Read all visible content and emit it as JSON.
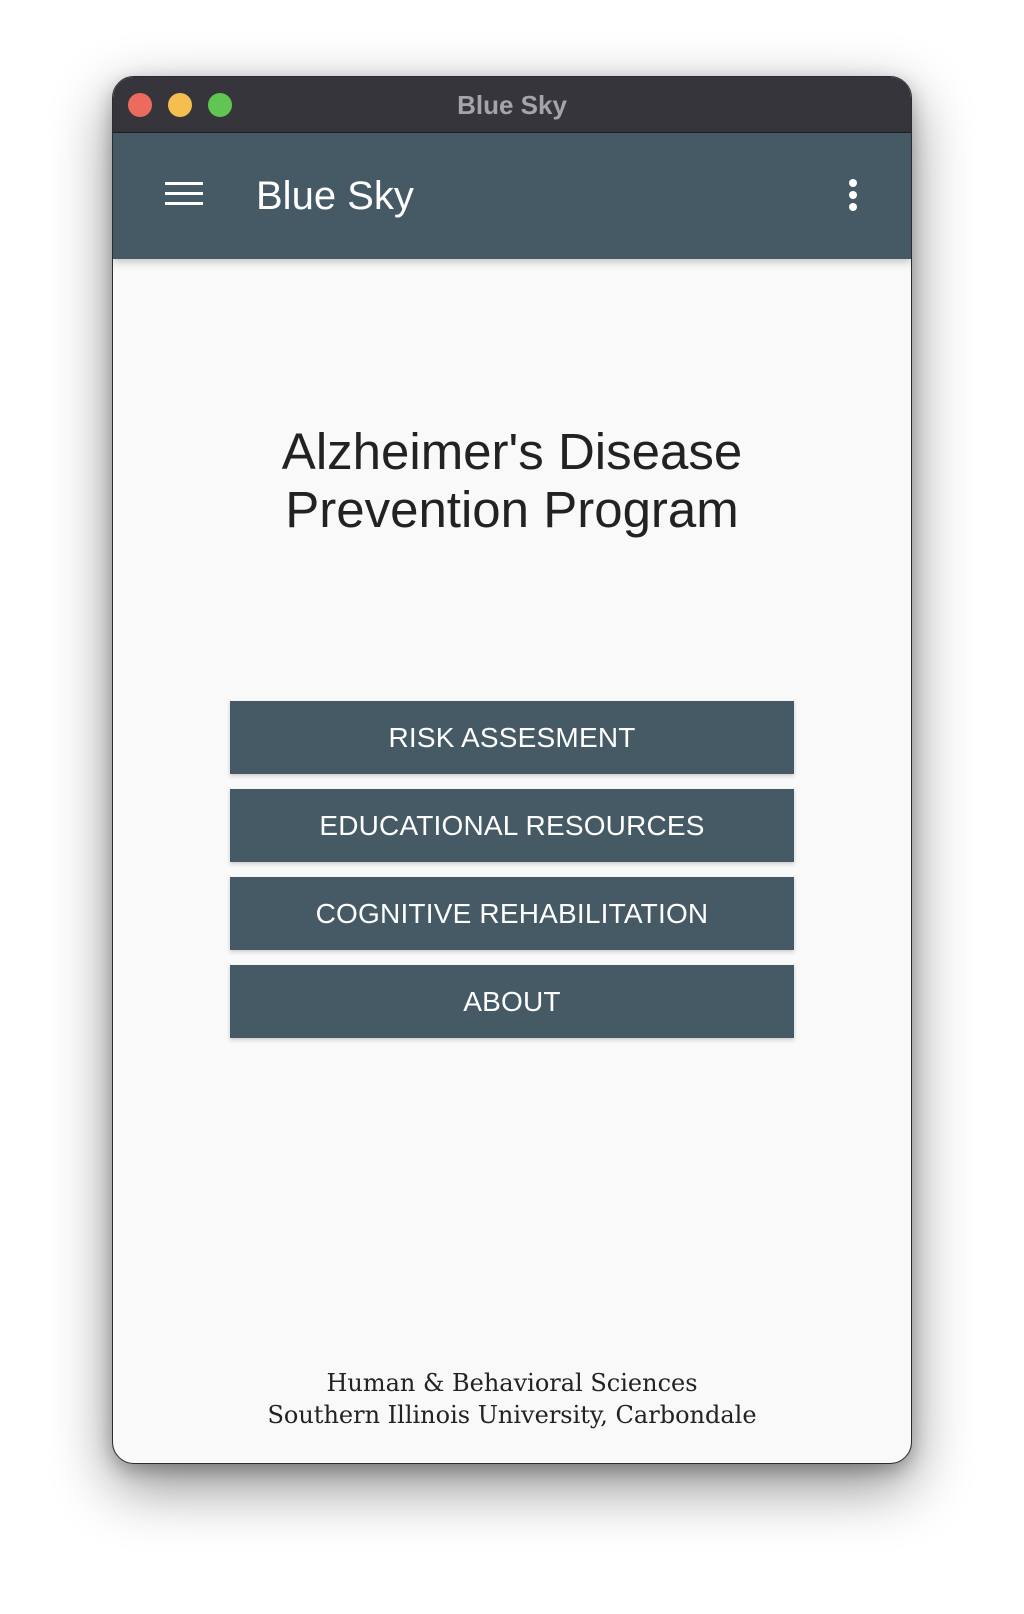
{
  "window": {
    "title": "Blue Sky"
  },
  "colors": {
    "appbar": "#455a64",
    "button": "#455a64",
    "background": "#f9f9f9",
    "titlebar": "#36353c",
    "traffic_close": "#ed6a5e",
    "traffic_minimize": "#f5bf4f",
    "traffic_zoom": "#61c554"
  },
  "appbar": {
    "menu_icon": "hamburger-menu-icon",
    "title": "Blue Sky",
    "overflow_icon": "more-vertical-icon"
  },
  "main": {
    "heading_line1": "Alzheimer's Disease",
    "heading_line2": "Prevention Program",
    "buttons": [
      {
        "label": "RISK ASSESMENT"
      },
      {
        "label": "EDUCATIONAL RESOURCES"
      },
      {
        "label": "COGNITIVE REHABILITATION"
      },
      {
        "label": "ABOUT"
      }
    ]
  },
  "footer": {
    "line1": "Human & Behavioral Sciences",
    "line2": "Southern Illinois University, Carbondale"
  }
}
